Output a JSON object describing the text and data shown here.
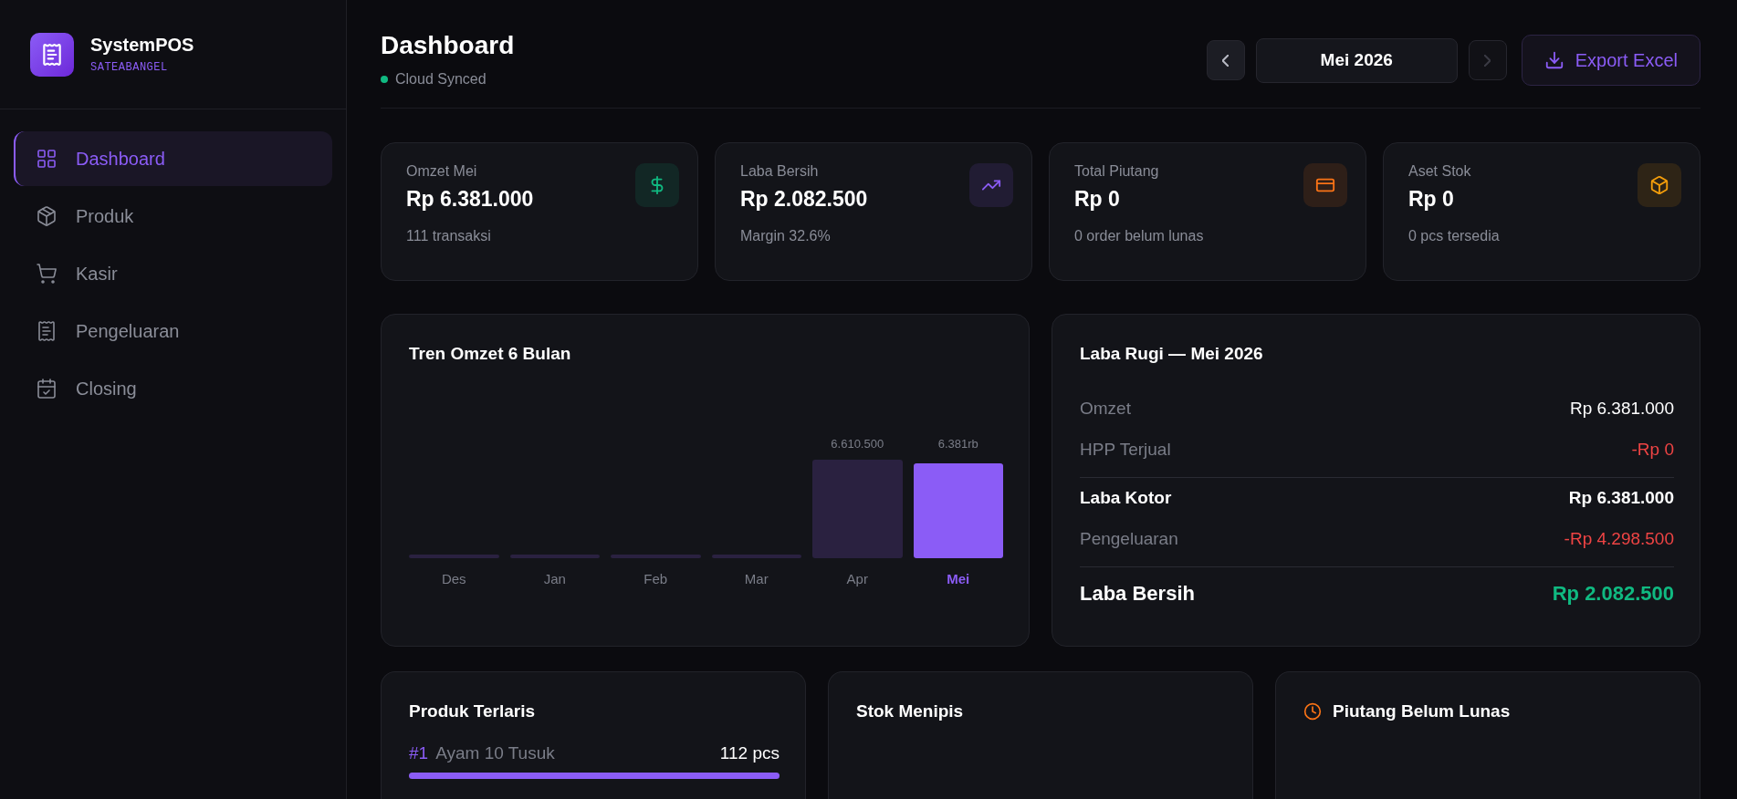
{
  "brand": {
    "name": "SystemPOS",
    "store": "SATEABANGEL"
  },
  "sidebar": {
    "items": [
      {
        "label": "Dashboard",
        "selected": true
      },
      {
        "label": "Produk",
        "selected": false
      },
      {
        "label": "Kasir",
        "selected": false
      },
      {
        "label": "Pengeluaran",
        "selected": false
      },
      {
        "label": "Closing",
        "selected": false
      }
    ]
  },
  "header": {
    "title": "Dashboard",
    "sync_status": "Cloud Synced",
    "month": "Mei 2026",
    "prev_disabled": false,
    "next_disabled": true,
    "export_label": "Export Excel"
  },
  "stats": [
    {
      "label": "Omzet Mei",
      "value": "Rp 6.381.000",
      "sub": "111 transaksi",
      "color": "#10b981"
    },
    {
      "label": "Laba Bersih",
      "value": "Rp 2.082.500",
      "sub": "Margin 32.6%",
      "color": "#8b5cf6"
    },
    {
      "label": "Total Piutang",
      "value": "Rp 0",
      "sub": "0 order belum lunas",
      "color": "#f97316"
    },
    {
      "label": "Aset Stok",
      "value": "Rp 0",
      "sub": "0 pcs tersedia",
      "color": "#f59e0b"
    }
  ],
  "trend": {
    "title": "Tren Omzet 6 Bulan",
    "bars": [
      {
        "month": "Des",
        "level": 0,
        "selected": false
      },
      {
        "month": "Jan",
        "level": 0,
        "selected": false
      },
      {
        "month": "Feb",
        "level": 0,
        "selected": false
      },
      {
        "month": "Mar",
        "level": 0,
        "selected": false
      },
      {
        "month": "Apr",
        "level": 1,
        "label": "6.610.500",
        "selected": false
      },
      {
        "month": "Mei",
        "level": 0.965,
        "label": "6.381rb",
        "selected": true
      }
    ]
  },
  "profit_loss": {
    "title": "Laba Rugi — Mei 2026",
    "rows": [
      {
        "label": "Omzet",
        "value": "Rp 6.381.000",
        "kind": "plain",
        "divider_before": false
      },
      {
        "label": "HPP Terjual",
        "value": "-Rp 0",
        "kind": "negative",
        "divider_before": false
      },
      {
        "label": "Laba Kotor",
        "value": "Rp 6.381.000",
        "kind": "subtotal",
        "divider_before": true
      },
      {
        "label": "Pengeluaran",
        "value": "-Rp 4.298.500",
        "kind": "negative",
        "divider_before": false
      },
      {
        "label": "Laba Bersih",
        "value": "Rp 2.082.500",
        "kind": "total",
        "divider_before": true
      }
    ]
  },
  "top_products": {
    "title": "Produk Terlaris",
    "items": [
      {
        "rank": "#1",
        "name": "Ayam 10 Tusuk",
        "qty": "112 pcs",
        "level": 1.0
      }
    ]
  },
  "low_stock": {
    "title": "Stok Menipis"
  },
  "receivables": {
    "title": "Piutang Belum Lunas"
  }
}
